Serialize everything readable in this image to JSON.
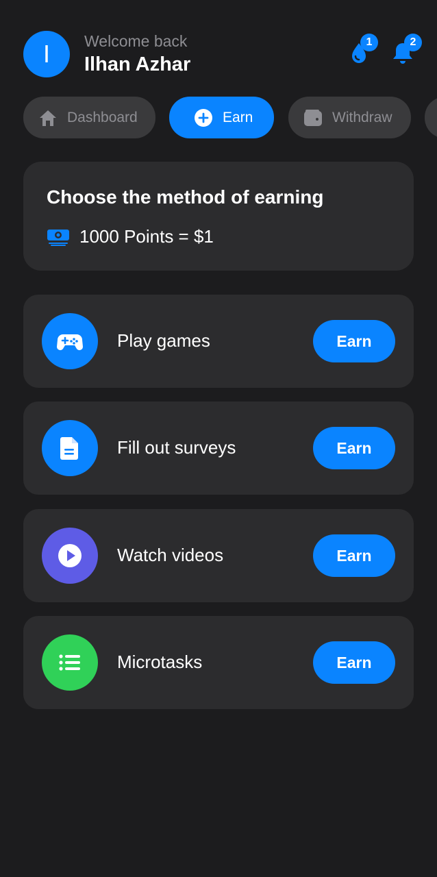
{
  "user": {
    "avatar_initial": "I",
    "welcome": "Welcome back",
    "name": "Ilhan Azhar"
  },
  "header_icons": [
    {
      "icon": "drop-icon",
      "badge": "1"
    },
    {
      "icon": "bell-icon",
      "badge": "2"
    }
  ],
  "tabs": [
    {
      "label": "Dashboard",
      "icon": "home-icon",
      "active": false
    },
    {
      "label": "Earn",
      "icon": "plus-circle-icon",
      "active": true
    },
    {
      "label": "Withdraw",
      "icon": "wallet-icon",
      "active": false
    }
  ],
  "info": {
    "title": "Choose the method of earning",
    "rate": "1000 Points = $1",
    "rate_icon": "money-icon"
  },
  "methods": [
    {
      "label": "Play games",
      "icon": "gamepad-icon",
      "color": "#0a84ff",
      "button": "Earn"
    },
    {
      "label": "Fill out surveys",
      "icon": "document-icon",
      "color": "#0a84ff",
      "button": "Earn"
    },
    {
      "label": "Watch videos",
      "icon": "play-icon",
      "color": "#5e5ce6",
      "button": "Earn"
    },
    {
      "label": "Microtasks",
      "icon": "list-icon",
      "color": "#30d158",
      "button": "Earn"
    }
  ],
  "colors": {
    "background": "#1c1c1e",
    "card": "#2c2c2e",
    "accent": "#0a84ff",
    "tab_inactive": "#3a3a3c",
    "muted_text": "#8e8e93"
  }
}
